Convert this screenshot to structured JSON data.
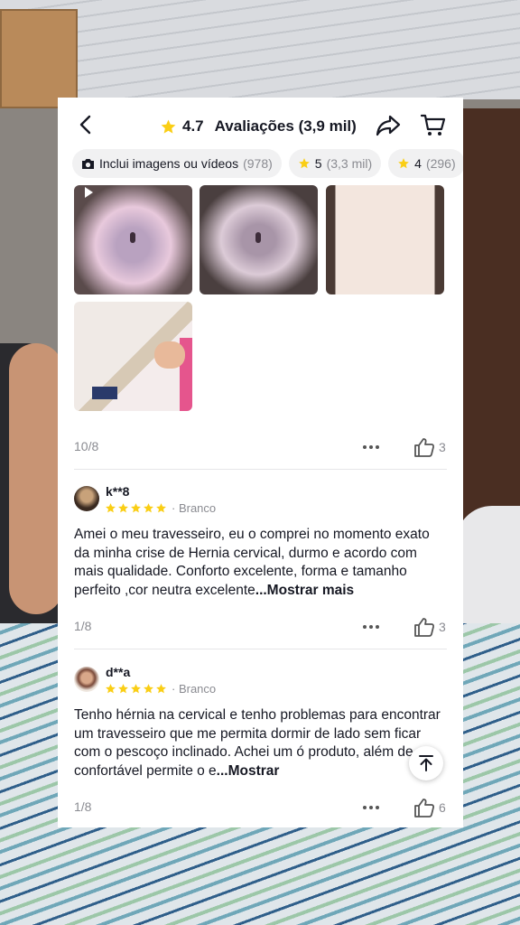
{
  "header": {
    "rating": "4.7",
    "title": "Avaliações (3,9 mil)"
  },
  "filters": [
    {
      "icon": "camera-icon",
      "label": "Inclui imagens ou vídeos",
      "count": "(978)"
    },
    {
      "icon": "star-icon",
      "label": "5",
      "count": "(3,3 mil)"
    },
    {
      "icon": "star-icon",
      "label": "4",
      "count": "(296)"
    }
  ],
  "first_review": {
    "pager": "10/8",
    "likes": "3"
  },
  "reviews": [
    {
      "name": "k**8",
      "rating": 5,
      "variant": "· Branco",
      "text": "Amei o meu travesseiro, eu o comprei no momento exato da minha crise de Hernia cervical, durmo e acordo com mais qualidade. Conforto excelente,  forma e tamanho perfeito  ,cor neutra excelente",
      "more": "...Mostrar mais",
      "pager": "1/8",
      "likes": "3"
    },
    {
      "name": "d**a",
      "rating": 5,
      "variant": "· Branco",
      "text": "Tenho hérnia na cervical e tenho problemas para encontrar um travesseiro que me permita dormir de lado sem ficar com o pescoço inclinado. Achei um ó  produto, além de confortável permite o e",
      "more": "...Mostrar",
      "pager": "1/8",
      "likes": "6"
    }
  ],
  "colors": {
    "star": "#FACE15",
    "text": "#161823",
    "muted": "#8A8B91"
  }
}
